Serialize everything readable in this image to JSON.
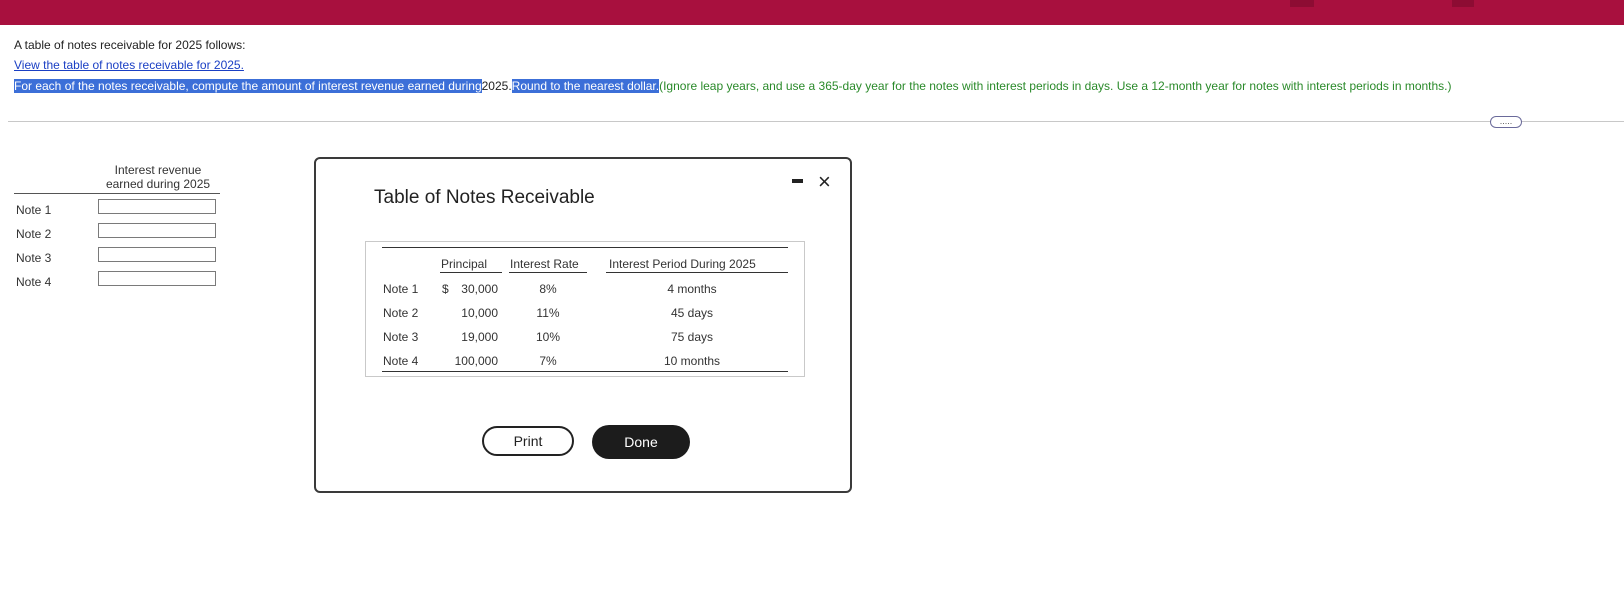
{
  "colors": {
    "topbar": "#a8103e",
    "highlight": "#3c6fd8",
    "instruction_green": "#2a8a2a",
    "link": "#1a3fc4"
  },
  "question": {
    "intro": "A table of notes receivable for 2025 follows:",
    "link_text": "View the table of notes receivable for 2025.",
    "instruction_highlight_1": "For each of the notes receivable, compute the amount of interest revenue earned during",
    "instruction_year": "2025.",
    "instruction_highlight_2": "Round to the nearest dollar.",
    "instruction_green": "(Ignore leap years, and use a 365-day year for the notes with interest periods in days. Use a 12-month year for notes with interest periods in months.)",
    "more_button": "....."
  },
  "answer_table": {
    "header_line1": "Interest revenue",
    "header_line2": "earned during 2025",
    "rows": [
      "Note 1",
      "Note 2",
      "Note 3",
      "Note 4"
    ]
  },
  "modal": {
    "title": "Table of Notes Receivable",
    "minimize_icon": "minimize-icon",
    "close_glyph": "×",
    "columns": [
      "Principal",
      "Interest Rate",
      "Interest Period During 2025"
    ],
    "rows": [
      {
        "note": "Note 1",
        "currency": "$",
        "principal": "30,000",
        "rate": "8%",
        "period": "4 months"
      },
      {
        "note": "Note 2",
        "currency": "",
        "principal": "10,000",
        "rate": "11%",
        "period": "45 days"
      },
      {
        "note": "Note 3",
        "currency": "",
        "principal": "19,000",
        "rate": "10%",
        "period": "75 days"
      },
      {
        "note": "Note 4",
        "currency": "",
        "principal": "100,000",
        "rate": "7%",
        "period": "10 months"
      }
    ],
    "print_label": "Print",
    "done_label": "Done"
  }
}
